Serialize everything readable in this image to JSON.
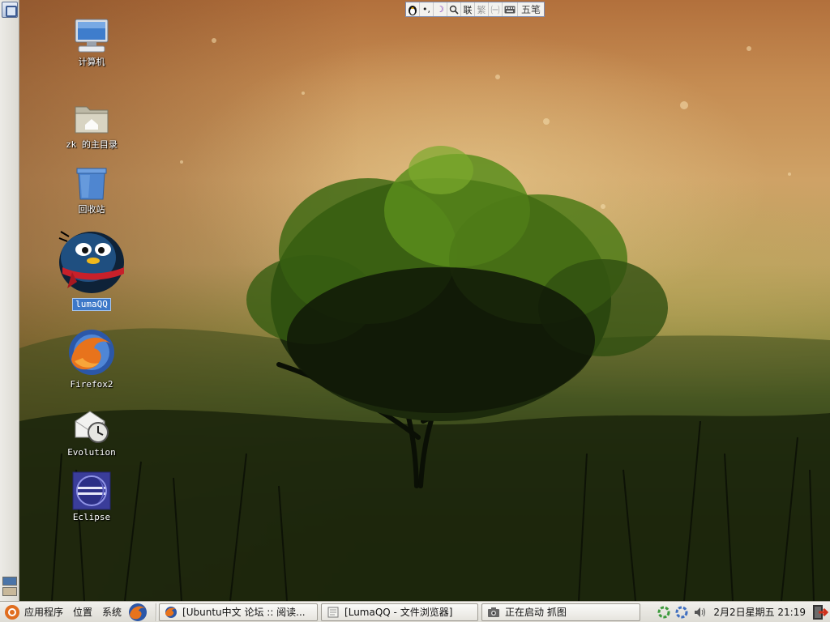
{
  "ime_bar": {
    "items": [
      {
        "name": "ime-logo-penguin-icon",
        "text": ""
      },
      {
        "name": "ime-punctuation-icon",
        "text": "•,"
      },
      {
        "name": "ime-moon-icon",
        "text": "☽"
      },
      {
        "name": "ime-search-icon",
        "text": "🔎"
      },
      {
        "name": "ime-lianxiang",
        "text": "联"
      },
      {
        "name": "ime-fanti",
        "text": "繁"
      },
      {
        "name": "ime-quanjiao",
        "text": "㈠"
      },
      {
        "name": "ime-keyboard-icon",
        "text": "⌨"
      },
      {
        "name": "ime-mode",
        "text": "五笔"
      }
    ]
  },
  "desktop_icons": [
    {
      "label": "计算机",
      "icon": "computer-icon"
    },
    {
      "label": "zk 的主目录",
      "icon": "home-folder-icon"
    },
    {
      "label": "回收站",
      "icon": "trash-icon"
    },
    {
      "label": "lumaQQ",
      "icon": "qq-penguin-icon",
      "selected": true
    },
    {
      "label": "Firefox2",
      "icon": "firefox-icon"
    },
    {
      "label": "Evolution",
      "icon": "evolution-icon"
    },
    {
      "label": "Eclipse",
      "icon": "eclipse-icon"
    }
  ],
  "bottom_panel": {
    "menus": [
      "应用程序",
      "位置",
      "系统"
    ],
    "tasks": [
      {
        "label": "[Ubuntu中文 论坛 :: 阅读...",
        "icon": "firefox-icon"
      },
      {
        "label": "[LumaQQ - 文件浏览器]",
        "icon": "file-browser-icon"
      },
      {
        "label": "正在启动 抓图",
        "icon": "camera-icon"
      }
    ],
    "clock": "2月2日星期五 21:19"
  },
  "colors": {
    "selection": "#3d78c8",
    "panel_bg": "#e8e7e2",
    "workspace_active": "#4a74a8"
  }
}
